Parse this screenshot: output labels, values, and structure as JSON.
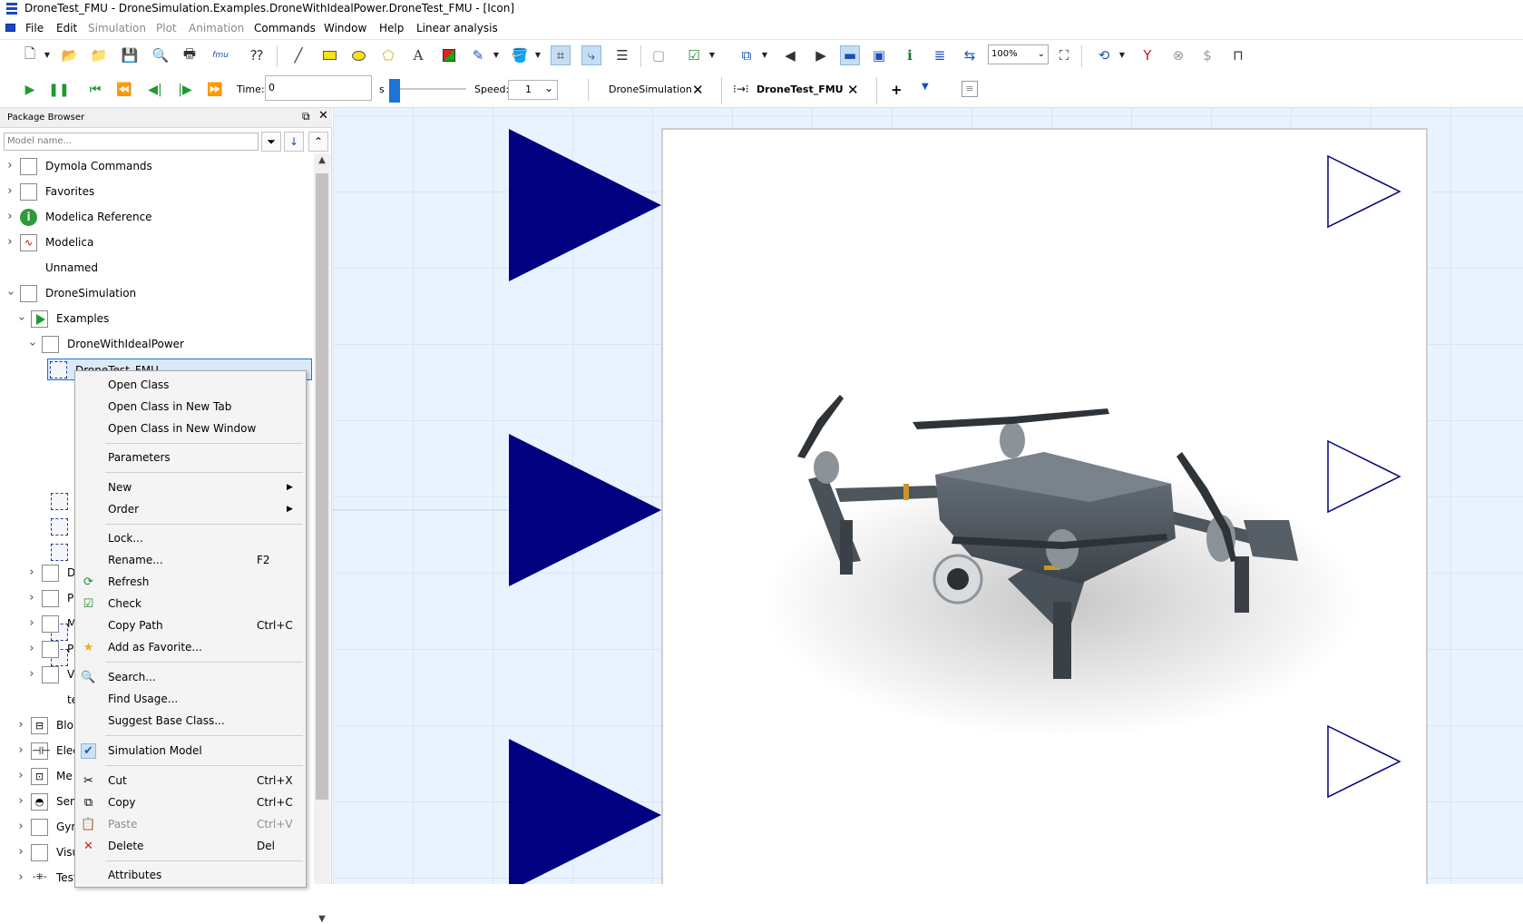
{
  "window": {
    "title": "DroneTest_FMU - DroneSimulation.Examples.DroneWithIdealPower.DroneTest_FMU - [Icon]"
  },
  "menu": [
    {
      "label": "File",
      "enabled": true
    },
    {
      "label": "Edit",
      "enabled": true
    },
    {
      "label": "Simulation",
      "enabled": false
    },
    {
      "label": "Plot",
      "enabled": false
    },
    {
      "label": "Animation",
      "enabled": false
    },
    {
      "label": "Commands",
      "enabled": true
    },
    {
      "label": "Window",
      "enabled": true
    },
    {
      "label": "Help",
      "enabled": true
    },
    {
      "label": "Linear analysis",
      "enabled": true
    }
  ],
  "toolbar": {
    "fmu_label": "fmu",
    "zoom_value": "100%"
  },
  "sim_toolbar": {
    "time_label": "Time:",
    "time_value": "0",
    "time_unit": "s",
    "speed_label": "Speed:",
    "speed_value": "1"
  },
  "tabs": [
    {
      "label": "DroneSimulation",
      "active": false
    },
    {
      "label": "DroneTest_FMU",
      "active": true
    }
  ],
  "package_browser": {
    "title": "Package Browser",
    "filter_placeholder": "Model name...",
    "items": [
      {
        "label": "Dymola Commands",
        "expanded": false
      },
      {
        "label": "Favorites",
        "expanded": false
      },
      {
        "label": "Modelica Reference",
        "expanded": false,
        "icon": "info-icon"
      },
      {
        "label": "Modelica",
        "expanded": false
      },
      {
        "label": "Unnamed",
        "expanded": null
      },
      {
        "label": "DroneSimulation",
        "expanded": true
      },
      {
        "label": "Examples",
        "expanded": true
      },
      {
        "label": "DroneWithIdealPower",
        "expanded": true
      },
      {
        "label": "DroneTest_FMU",
        "selected": true
      },
      {
        "label": "te"
      },
      {
        "label": "Blo"
      },
      {
        "label": "Elec"
      },
      {
        "label": "Me"
      },
      {
        "label": "Sen"
      },
      {
        "label": "Gyr"
      },
      {
        "label": "Visu"
      },
      {
        "label": "Test"
      }
    ],
    "partial_letters": [
      "D",
      "P",
      "M",
      "P",
      "V"
    ]
  },
  "context_menu": {
    "items": [
      {
        "label": "Open Class"
      },
      {
        "label": "Open Class in New Tab"
      },
      {
        "label": "Open Class in New Window"
      },
      {
        "label": "Parameters"
      },
      {
        "label": "New",
        "submenu": true
      },
      {
        "label": "Order",
        "submenu": true
      },
      {
        "label": "Lock..."
      },
      {
        "label": "Rename...",
        "shortcut": "F2"
      },
      {
        "label": "Refresh",
        "icon": "refresh-icon"
      },
      {
        "label": "Check",
        "icon": "check-icon"
      },
      {
        "label": "Copy Path",
        "shortcut": "Ctrl+C"
      },
      {
        "label": "Add as Favorite...",
        "icon": "star-icon"
      },
      {
        "label": "Search...",
        "icon": "search-icon"
      },
      {
        "label": "Find Usage..."
      },
      {
        "label": "Suggest Base Class..."
      },
      {
        "label": "Simulation Model",
        "checked": true
      },
      {
        "label": "Cut",
        "shortcut": "Ctrl+X",
        "icon": "scissors-icon"
      },
      {
        "label": "Copy",
        "shortcut": "Ctrl+C",
        "icon": "copy-icon"
      },
      {
        "label": "Paste",
        "shortcut": "Ctrl+V",
        "icon": "paste-icon",
        "disabled": true
      },
      {
        "label": "Delete",
        "shortcut": "Del",
        "icon": "delete-icon"
      },
      {
        "label": "Attributes"
      }
    ]
  },
  "colors": {
    "input_port": "#000080",
    "output_port": "#ffffff",
    "canvas_bg": "#e8f3ff",
    "accent": "#1e73d4"
  }
}
